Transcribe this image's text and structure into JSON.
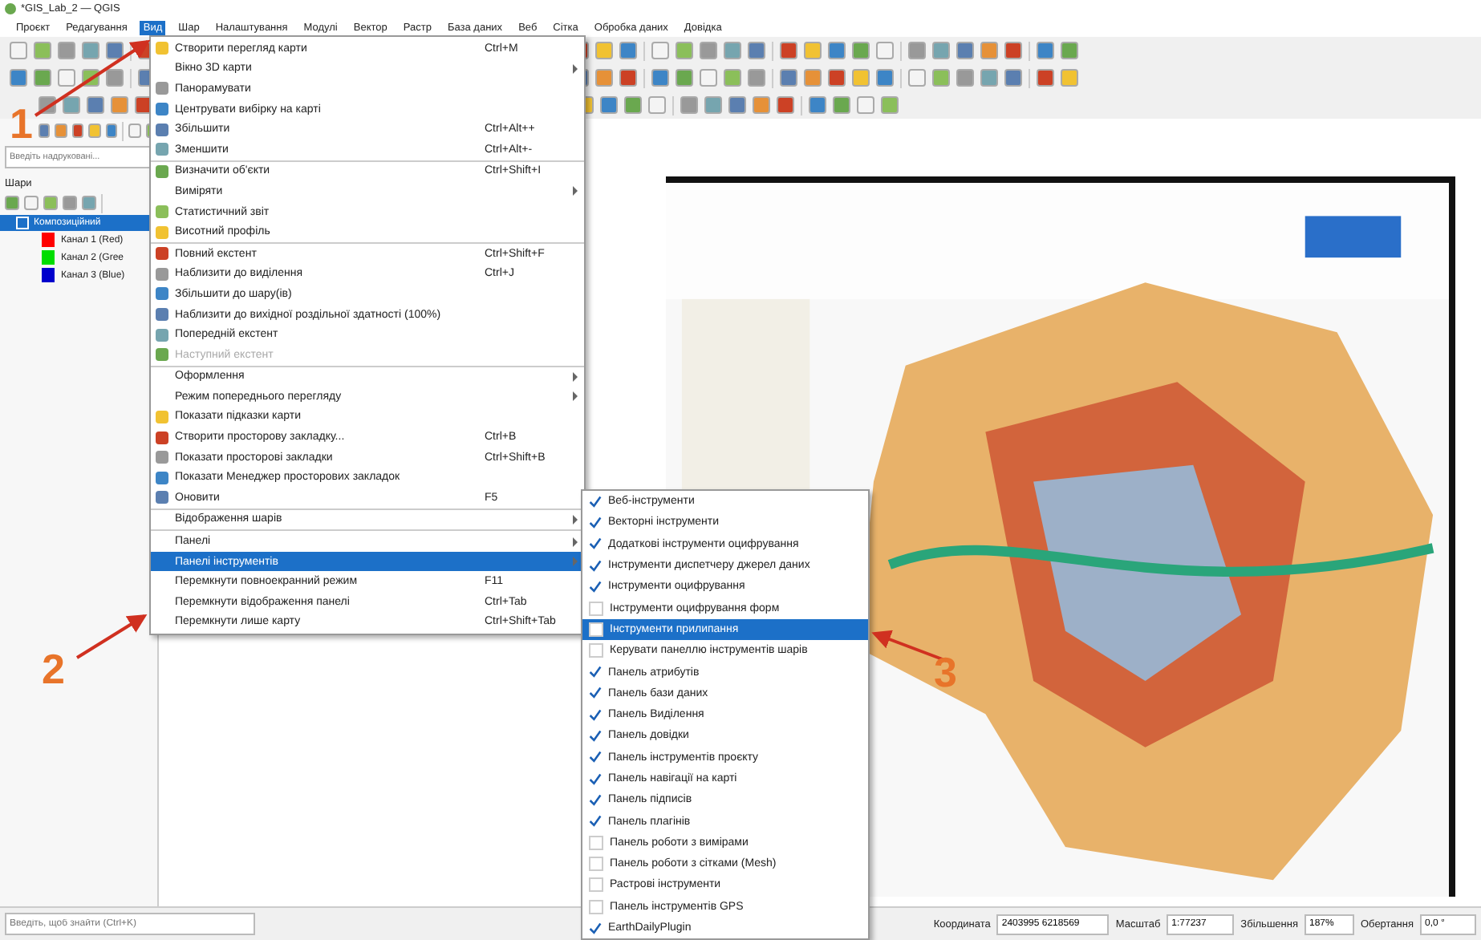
{
  "window": {
    "title": "*GIS_Lab_2 — QGIS"
  },
  "menubar": [
    {
      "label": "Проєкт",
      "selected": false
    },
    {
      "label": "Редагування",
      "selected": false
    },
    {
      "label": "Вид",
      "selected": true
    },
    {
      "label": "Шар",
      "selected": false
    },
    {
      "label": "Налаштування",
      "selected": false
    },
    {
      "label": "Модулі",
      "selected": false
    },
    {
      "label": "Вектор",
      "selected": false
    },
    {
      "label": "Растр",
      "selected": false
    },
    {
      "label": "База даних",
      "selected": false
    },
    {
      "label": "Веб",
      "selected": false
    },
    {
      "label": "Сітка",
      "selected": false
    },
    {
      "label": "Обробка даних",
      "selected": false
    },
    {
      "label": "Довідка",
      "selected": false
    }
  ],
  "view_menu": [
    {
      "label": "Створити перегляд карти",
      "shortcut": "Ctrl+M",
      "icon": true,
      "submenu": false,
      "disabled": false,
      "selected": false,
      "separator_before": false
    },
    {
      "label": "Вікно 3D карти",
      "icon": false,
      "submenu": true,
      "disabled": false,
      "selected": false,
      "separator_before": false
    },
    {
      "label": "Панорамувати",
      "icon": true,
      "submenu": false,
      "disabled": false,
      "selected": false,
      "separator_before": false
    },
    {
      "label": "Центрувати вибірку на карті",
      "icon": true,
      "submenu": false,
      "disabled": false,
      "selected": false,
      "separator_before": false
    },
    {
      "label": "Збільшити",
      "shortcut": "Ctrl+Alt++",
      "icon": true,
      "submenu": false,
      "disabled": false,
      "selected": false,
      "separator_before": false
    },
    {
      "label": "Зменшити",
      "shortcut": "Ctrl+Alt+-",
      "icon": true,
      "submenu": false,
      "disabled": false,
      "selected": false,
      "separator_before": false
    },
    {
      "label": "Визначити об'єкти",
      "shortcut": "Ctrl+Shift+I",
      "icon": true,
      "submenu": false,
      "disabled": false,
      "selected": false,
      "separator_before": true
    },
    {
      "label": "Виміряти",
      "icon": false,
      "submenu": true,
      "disabled": false,
      "selected": false,
      "separator_before": false
    },
    {
      "label": "Статистичний звіт",
      "icon": true,
      "submenu": false,
      "disabled": false,
      "selected": false,
      "separator_before": false
    },
    {
      "label": "Висотний профіль",
      "icon": true,
      "submenu": false,
      "disabled": false,
      "selected": false,
      "separator_before": false
    },
    {
      "label": "Повний екстент",
      "shortcut": "Ctrl+Shift+F",
      "icon": true,
      "submenu": false,
      "disabled": false,
      "selected": false,
      "separator_before": true
    },
    {
      "label": "Наблизити до виділення",
      "shortcut": "Ctrl+J",
      "icon": true,
      "submenu": false,
      "disabled": false,
      "selected": false,
      "separator_before": false
    },
    {
      "label": "Збільшити до шару(ів)",
      "icon": true,
      "submenu": false,
      "disabled": false,
      "selected": false,
      "separator_before": false
    },
    {
      "label": "Наблизити до вихідної роздільної здатності (100%)",
      "icon": true,
      "submenu": false,
      "disabled": false,
      "selected": false,
      "separator_before": false
    },
    {
      "label": "Попередній екстент",
      "icon": true,
      "submenu": false,
      "disabled": false,
      "selected": false,
      "separator_before": false
    },
    {
      "label": "Наступний екстент",
      "icon": true,
      "submenu": false,
      "disabled": true,
      "selected": false,
      "separator_before": false
    },
    {
      "label": "Оформлення",
      "icon": false,
      "submenu": true,
      "disabled": false,
      "selected": false,
      "separator_before": true
    },
    {
      "label": "Режим попереднього перегляду",
      "icon": false,
      "submenu": true,
      "disabled": false,
      "selected": false,
      "separator_before": false
    },
    {
      "label": "Показати підказки карти",
      "icon": true,
      "submenu": false,
      "disabled": false,
      "selected": false,
      "separator_before": false
    },
    {
      "label": "Створити просторову закладку...",
      "shortcut": "Ctrl+B",
      "icon": true,
      "submenu": false,
      "disabled": false,
      "selected": false,
      "separator_before": false
    },
    {
      "label": "Показати просторові закладки",
      "shortcut": "Ctrl+Shift+B",
      "icon": true,
      "submenu": false,
      "disabled": false,
      "selected": false,
      "separator_before": false
    },
    {
      "label": "Показати Менеджер просторових закладок",
      "icon": true,
      "submenu": false,
      "disabled": false,
      "selected": false,
      "separator_before": false
    },
    {
      "label": "Оновити",
      "shortcut": "F5",
      "icon": true,
      "submenu": false,
      "disabled": false,
      "selected": false,
      "separator_before": false
    },
    {
      "label": "Відображення шарів",
      "icon": false,
      "submenu": true,
      "disabled": false,
      "selected": false,
      "separator_before": true
    },
    {
      "label": "Панелі",
      "icon": false,
      "submenu": true,
      "disabled": false,
      "selected": false,
      "separator_before": true
    },
    {
      "label": "Панелі інструментів",
      "icon": false,
      "submenu": true,
      "disabled": false,
      "selected": true,
      "separator_before": false
    },
    {
      "label": "Перемкнути повноекранний режим",
      "shortcut": "F11",
      "icon": false,
      "submenu": false,
      "disabled": false,
      "selected": false,
      "separator_before": false
    },
    {
      "label": "Перемкнути відображення панелі",
      "shortcut": "Ctrl+Tab",
      "icon": false,
      "submenu": false,
      "disabled": false,
      "selected": false,
      "separator_before": false
    },
    {
      "label": "Перемкнути лише карту",
      "shortcut": "Ctrl+Shift+Tab",
      "icon": false,
      "submenu": false,
      "disabled": false,
      "selected": false,
      "separator_before": false
    }
  ],
  "toolbars_menu": [
    {
      "label": "Веб-інструменти",
      "checked": true,
      "selected": false
    },
    {
      "label": "Векторні інструменти",
      "checked": true,
      "selected": false
    },
    {
      "label": "Додаткові інструменти оцифрування",
      "checked": true,
      "selected": false
    },
    {
      "label": "Інструменти диспетчеру джерел даних",
      "checked": true,
      "selected": false
    },
    {
      "label": "Інструменти оцифрування",
      "checked": true,
      "selected": false
    },
    {
      "label": "Інструменти оцифрування форм",
      "checked": false,
      "selected": false
    },
    {
      "label": "Інструменти прилипання",
      "checked": false,
      "selected": true
    },
    {
      "label": "Керувати панеллю інструментів шарів",
      "checked": false,
      "selected": false
    },
    {
      "label": "Панель атрибутів",
      "checked": true,
      "selected": false
    },
    {
      "label": "Панель бази даних",
      "checked": true,
      "selected": false
    },
    {
      "label": "Панель Виділення",
      "checked": true,
      "selected": false
    },
    {
      "label": "Панель довідки",
      "checked": true,
      "selected": false
    },
    {
      "label": "Панель інструментів проєкту",
      "checked": true,
      "selected": false
    },
    {
      "label": "Панель навігації на карті",
      "checked": true,
      "selected": false
    },
    {
      "label": "Панель підписів",
      "checked": true,
      "selected": false
    },
    {
      "label": "Панель плагінів",
      "checked": true,
      "selected": false
    },
    {
      "label": "Панель роботи з вимірами",
      "checked": false,
      "selected": false
    },
    {
      "label": "Панель роботи з сітками (Mesh)",
      "checked": false,
      "selected": false
    },
    {
      "label": "Растрові інструменти",
      "checked": false,
      "selected": false
    },
    {
      "label": "Панель інструментів GPS",
      "checked": false,
      "selected": false
    },
    {
      "label": "EarthDailyPlugin",
      "checked": true,
      "selected": false
    }
  ],
  "layers_panel": {
    "search": {
      "placeholder": "Введіть надруковані..."
    },
    "title": "Шари",
    "layers": [
      {
        "label": "Композиційний",
        "checked": true,
        "selected": true,
        "children": [
          {
            "label": "Канал 1 (Red)",
            "color": "#ff0000"
          },
          {
            "label": "Канал 2 (Gree",
            "color": "#00dd00"
          },
          {
            "label": "Канал 3 (Blue)",
            "color": "#0000cc"
          }
        ]
      }
    ]
  },
  "annotations": [
    {
      "label": "1"
    },
    {
      "label": "2"
    },
    {
      "label": "3"
    }
  ],
  "status_bar": {
    "locator": {
      "placeholder": "Введіть, щоб знайти (Ctrl+K)"
    },
    "coordinate_label": "Координата",
    "coordinate": "2403995 6218569",
    "scale_label": "Масштаб",
    "scale": "1:77237",
    "magnifier_label": "Збільшення",
    "magnifier": "187%",
    "rotation_label": "Обертання",
    "rotation": "0,0 °"
  }
}
